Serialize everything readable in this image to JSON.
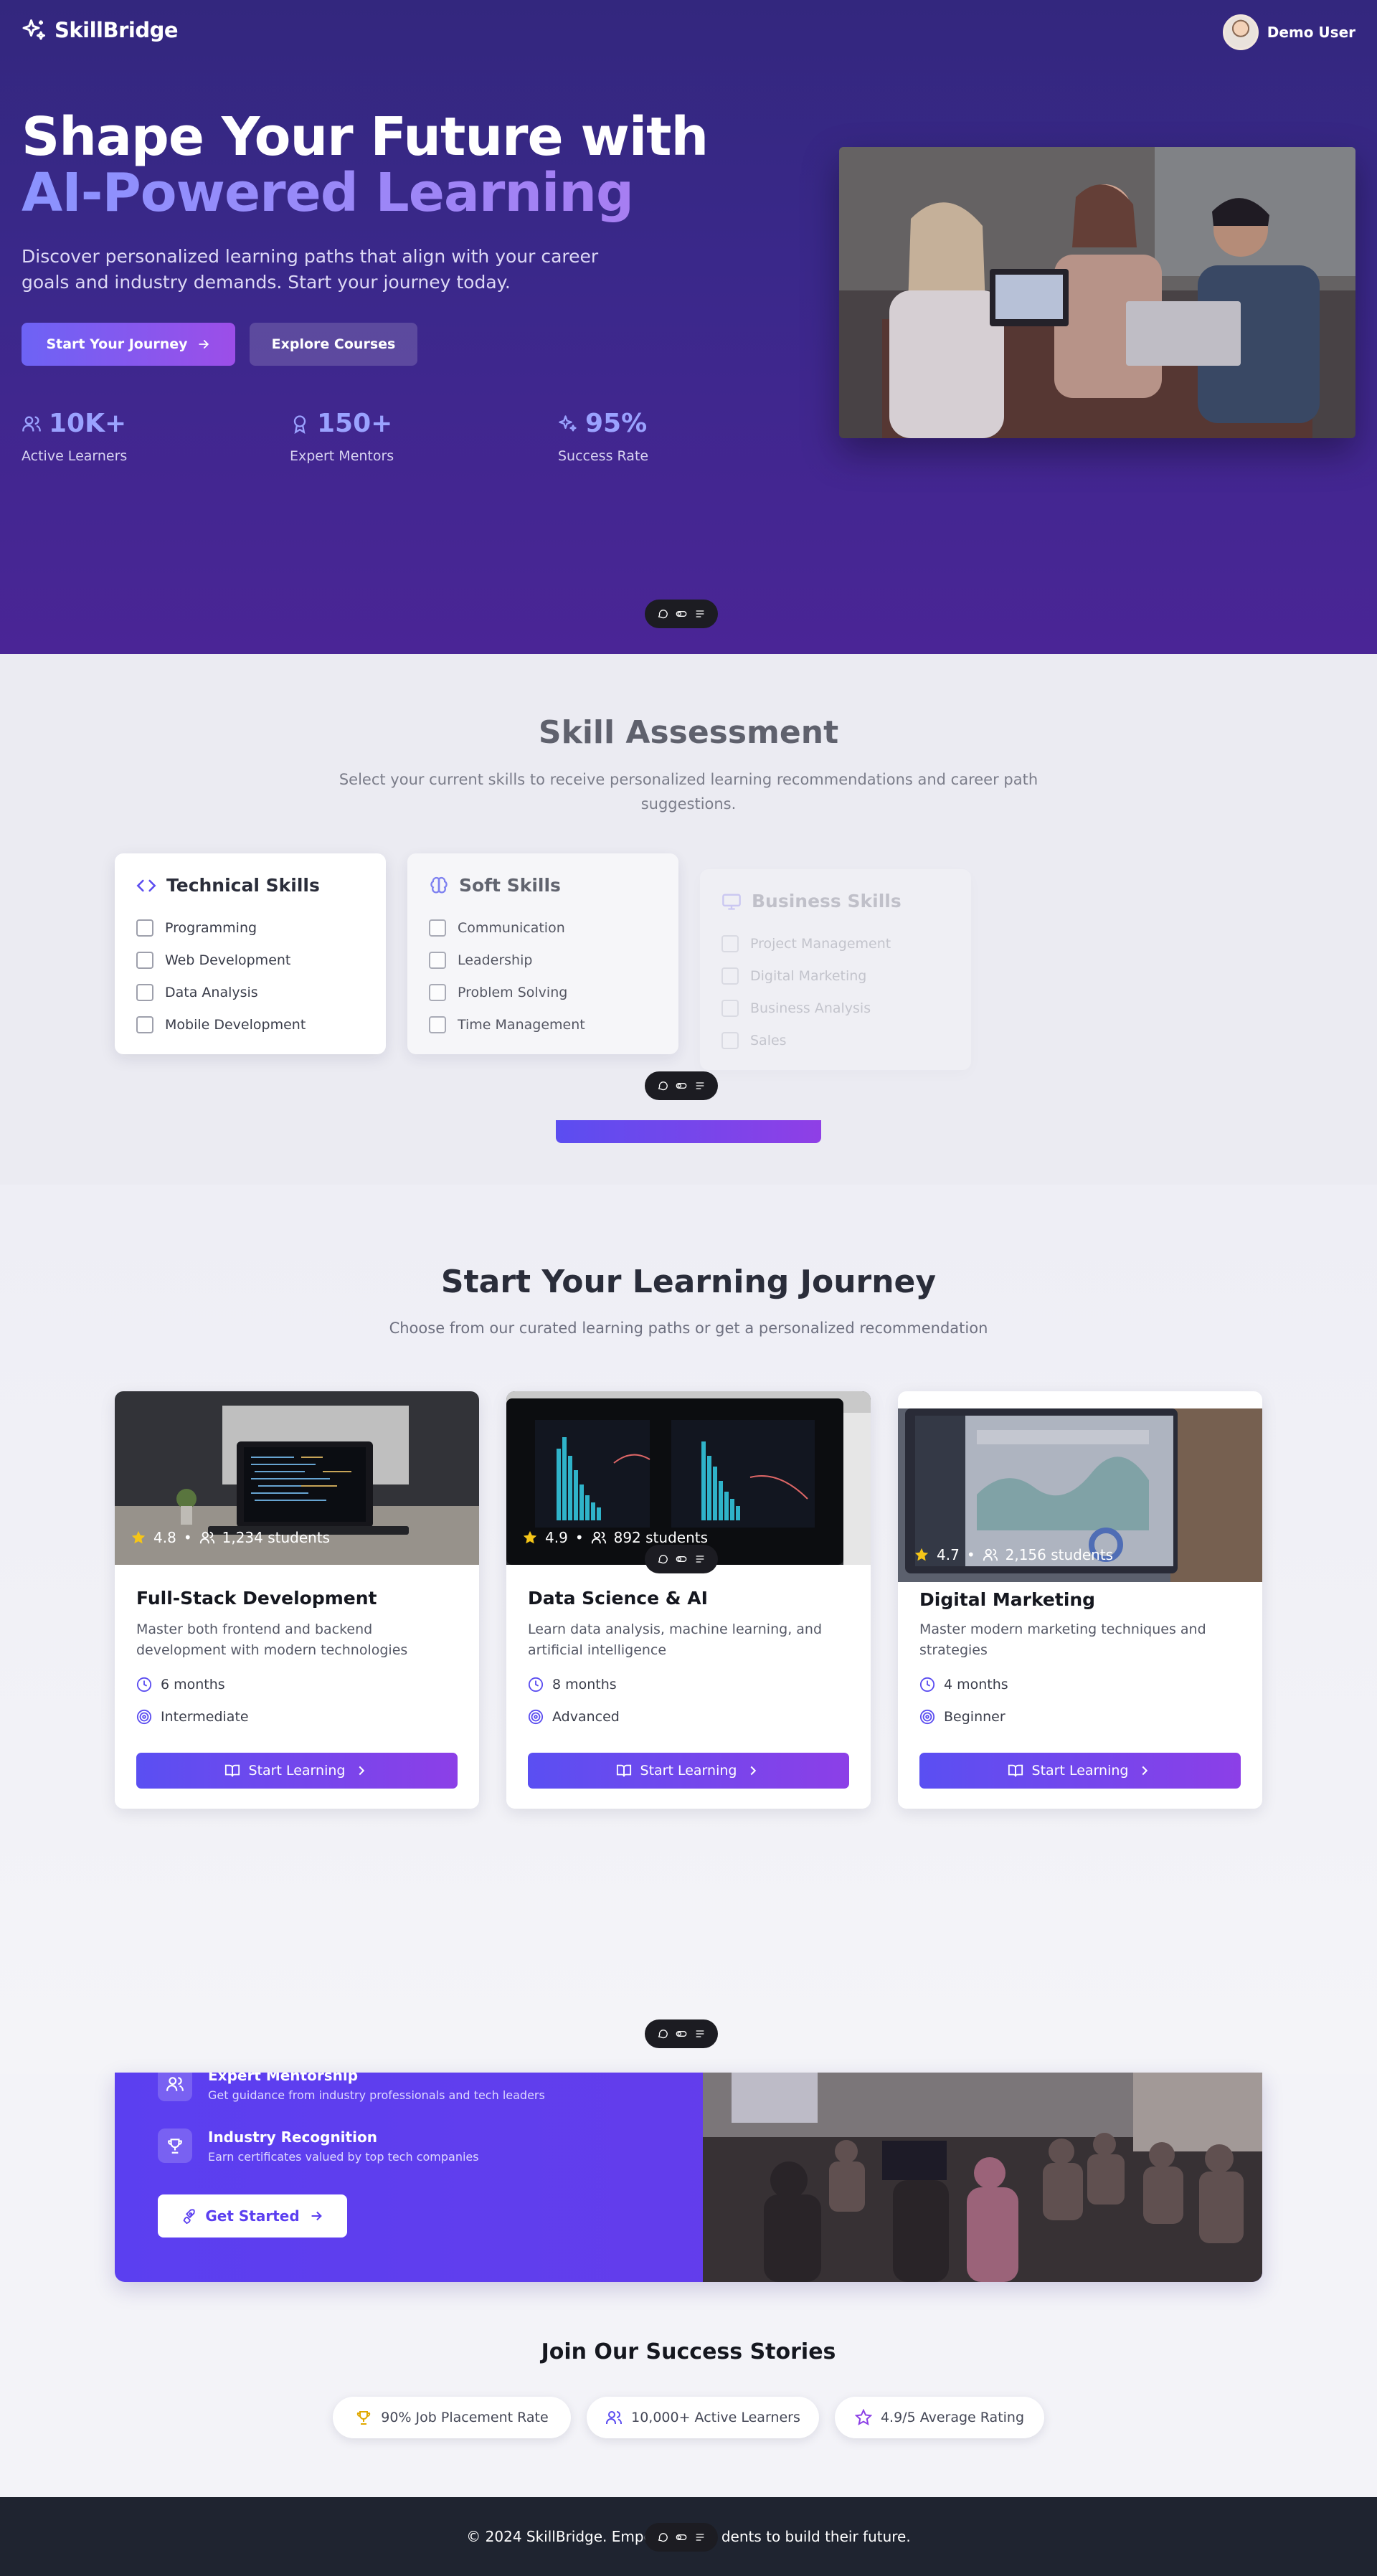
{
  "brand": {
    "name": "SkillBridge"
  },
  "header": {
    "user_name": "Demo User"
  },
  "hero": {
    "title_main": "Shape Your Future with ",
    "title_accent": "AI-Powered Learning",
    "subtitle": "Discover personalized learning paths that align with your career goals and industry demands. Start your journey today.",
    "primary_button": "Start Your Journey",
    "secondary_button": "Explore Courses",
    "stats": [
      {
        "value": "10K+",
        "label": "Active Learners",
        "icon": "users-icon"
      },
      {
        "value": "150+",
        "label": "Expert Mentors",
        "icon": "award-icon"
      },
      {
        "value": "95%",
        "label": "Success Rate",
        "icon": "sparkles-icon"
      }
    ]
  },
  "assessment": {
    "title": "Skill Assessment",
    "subtitle_line1": "Select your current skills to receive personalized learning recommendations and career path",
    "subtitle_line2": "suggestions.",
    "groups": [
      {
        "title": "Technical Skills",
        "icon": "code-icon",
        "items": [
          "Programming",
          "Web Development",
          "Data Analysis",
          "Mobile Development"
        ]
      },
      {
        "title": "Soft Skills",
        "icon": "brain-icon",
        "items": [
          "Communication",
          "Leadership",
          "Problem Solving",
          "Time Management"
        ]
      },
      {
        "title": "Business Skills",
        "icon": "monitor-icon",
        "items": [
          "Project Management",
          "Digital Marketing",
          "Business Analysis",
          "Sales"
        ]
      }
    ]
  },
  "journey": {
    "title": "Start Your Learning Journey",
    "subtitle": "Choose from our curated learning paths or get a personalized recommendation",
    "button_label": "Start Learning",
    "courses": [
      {
        "title": "Full-Stack Development",
        "rating": "4.8",
        "students": "1,234 students",
        "desc_line1": "Master both frontend and backend",
        "desc_line2": "development with modern technologies",
        "duration": "6 months",
        "level": "Intermediate"
      },
      {
        "title": "Data Science & AI",
        "rating": "4.9",
        "students": "892 students",
        "desc_line1": "Learn data analysis, machine learning, and",
        "desc_line2": "artificial intelligence",
        "duration": "8 months",
        "level": "Advanced"
      },
      {
        "title": "Digital Marketing",
        "rating": "4.7",
        "students": "2,156 students",
        "desc_line1": "Master modern marketing techniques and",
        "desc_line2": "strategies",
        "duration": "4 months",
        "level": "Beginner"
      }
    ]
  },
  "cta": {
    "features": [
      {
        "title": "Expert Mentorship",
        "desc": "Get guidance from industry professionals and tech leaders",
        "icon": "users-icon"
      },
      {
        "title": "Industry Recognition",
        "desc": "Earn certificates valued by top tech companies",
        "icon": "trophy-icon"
      }
    ],
    "button": "Get Started"
  },
  "success": {
    "title": "Join Our Success Stories",
    "badges": [
      {
        "label": "90% Job Placement Rate",
        "icon": "trophy-icon"
      },
      {
        "label": "10,000+ Active Learners",
        "icon": "users-icon"
      },
      {
        "label": "4.9/5 Average Rating",
        "icon": "star-icon"
      }
    ]
  },
  "footer": {
    "text_left": "© 2024 SkillBridge. Empo",
    "text_right": "dents to build their future."
  },
  "colors": {
    "hero_bg": "#3a288a",
    "accent": "#6d63f5",
    "accent_end": "#9c4ee8",
    "footer_bg": "#1f2430"
  }
}
